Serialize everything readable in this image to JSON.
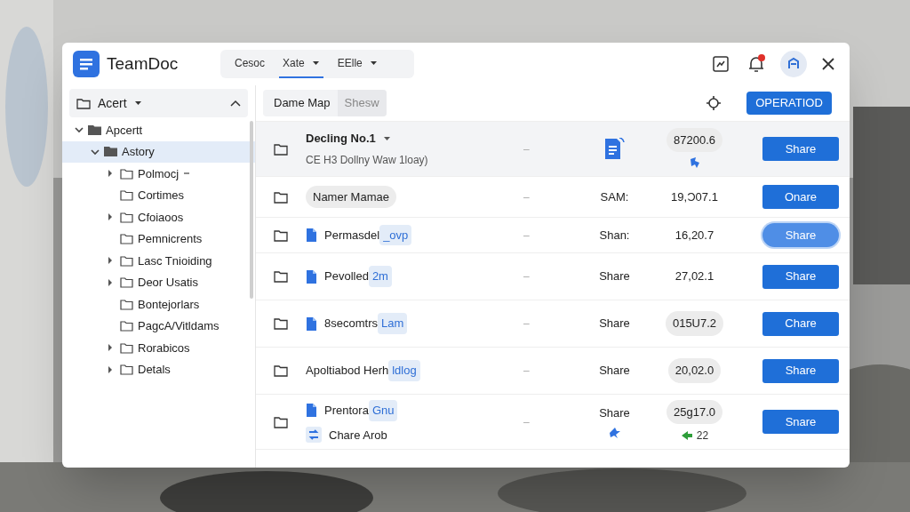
{
  "app": {
    "title": "TeamDoc"
  },
  "tabs": [
    {
      "label": "Cesoc",
      "dropdown": false,
      "selected": false
    },
    {
      "label": "Xate",
      "dropdown": true,
      "selected": true
    },
    {
      "label": "EElle",
      "dropdown": true,
      "selected": false
    }
  ],
  "notifications": {
    "badge": true
  },
  "sidebar": {
    "title": "Acert",
    "items": [
      {
        "label": "Apcertt",
        "kind": "branch",
        "expanded": true,
        "selected": false,
        "children": [
          {
            "label": "Astory",
            "kind": "branch",
            "expanded": true,
            "selected": true,
            "children": [
              {
                "label": "Polmocj",
                "kind": "branch",
                "expanded": false,
                "selected": false,
                "dropdown": true
              },
              {
                "label": "Cortimes",
                "kind": "leaf",
                "selected": false
              },
              {
                "label": "Cfoiaoos",
                "kind": "branch",
                "expanded": false,
                "selected": false
              },
              {
                "label": "Pemnicrents",
                "kind": "leaf",
                "selected": false
              },
              {
                "label": "Lasc Tnioiding",
                "kind": "branch",
                "expanded": false,
                "selected": false
              },
              {
                "label": "Deor Usatis",
                "kind": "branch",
                "expanded": false,
                "selected": false
              },
              {
                "label": "Bontejorlars",
                "kind": "leaf",
                "selected": false
              },
              {
                "label": "PagcA/Vitldams",
                "kind": "leaf",
                "selected": false
              },
              {
                "label": "Rorabicos",
                "kind": "branch",
                "expanded": false,
                "selected": false
              },
              {
                "label": "Detals",
                "kind": "branch",
                "expanded": false,
                "selected": false
              }
            ]
          }
        ]
      }
    ]
  },
  "toolbar": {
    "title": "Dame Map",
    "chip": "Shesw",
    "action": "OPERATIOD"
  },
  "rows": [
    {
      "name": "Decling No.1",
      "dropdown": true,
      "subtitle": "CE H3 Dollny Waw 1loay)",
      "file_icon": false,
      "name_pill": false,
      "dash": "–",
      "share_label": "",
      "date": "87200.6",
      "date_pill": true,
      "button": "Share",
      "focused": false,
      "selected": true
    },
    {
      "name": "Namer Mamae",
      "dropdown": false,
      "file_icon": false,
      "name_pill": true,
      "dash": "–",
      "share_label": "SAM:",
      "date": "19,Ɔ07.1",
      "date_pill": false,
      "button": "Onare",
      "focused": false,
      "selected": false
    },
    {
      "name": "Permasdel",
      "tag": "_ovp",
      "dropdown": false,
      "file_icon": true,
      "name_pill": false,
      "dash": "–",
      "share_label": "Shan:",
      "date": "16,20.7",
      "date_pill": false,
      "button": "Share",
      "focused": true,
      "selected": false
    },
    {
      "name": "Pevolled",
      "tag": "2m",
      "dropdown": false,
      "file_icon": true,
      "name_pill": false,
      "dash": "–",
      "share_label": "Share",
      "date": "27,02.1",
      "date_pill": false,
      "button": "Share",
      "focused": false,
      "selected": false
    },
    {
      "name": "8secomtrs",
      "tag": "Lam",
      "dropdown": false,
      "file_icon": true,
      "name_pill": false,
      "dash": "–",
      "share_label": "Share",
      "date": "015U7.2",
      "date_pill": true,
      "button": "Chare",
      "focused": false,
      "selected": false
    },
    {
      "name": "Apoltiabod Herh",
      "tag": "ldlog",
      "dropdown": false,
      "file_icon": false,
      "name_pill": false,
      "dash": "–",
      "share_label": "Share",
      "date": "20,02.0",
      "date_pill": true,
      "button": "Share",
      "focused": false,
      "selected": false
    },
    {
      "name": "Prentora",
      "tag": "Gnu",
      "second_line": "Chare Arob",
      "dropdown": false,
      "file_icon": true,
      "name_pill": false,
      "dash": "–",
      "share_label": "Share",
      "date": "25g17.0",
      "date_note": "22",
      "date_pill": true,
      "button": "Snare",
      "focused": false,
      "selected": false
    }
  ]
}
